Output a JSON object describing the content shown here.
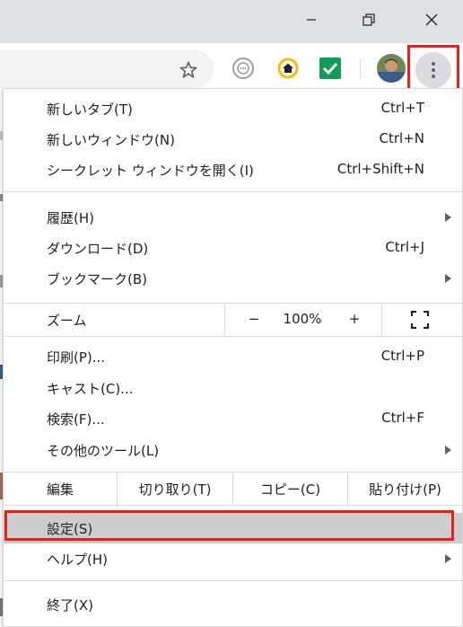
{
  "window": {
    "minimize": "minimize-icon",
    "maximize": "restore-icon",
    "close": "close-icon"
  },
  "toolbar": {
    "bookmark_star": "star-icon",
    "extensions": [
      "chat-extension-icon",
      "home-extension-icon",
      "check-extension-icon"
    ],
    "profile": "avatar",
    "menu_button": "more-vert-icon",
    "highlight_color": "#e2231a"
  },
  "menu": {
    "group1": [
      {
        "label": "新しいタブ(T)",
        "shortcut": "Ctrl+T"
      },
      {
        "label": "新しいウィンドウ(N)",
        "shortcut": "Ctrl+N"
      },
      {
        "label": "シークレット ウィンドウを開く(I)",
        "shortcut": "Ctrl+Shift+N"
      }
    ],
    "group2": [
      {
        "label": "履歴(H)",
        "submenu": true
      },
      {
        "label": "ダウンロード(D)",
        "shortcut": "Ctrl+J"
      },
      {
        "label": "ブックマーク(B)",
        "submenu": true
      }
    ],
    "zoom": {
      "label": "ズーム",
      "minus": "−",
      "value": "100%",
      "plus": "+",
      "fullscreen": "fullscreen-icon"
    },
    "group3": [
      {
        "label": "印刷(P)...",
        "shortcut": "Ctrl+P"
      },
      {
        "label": "キャスト(C)..."
      },
      {
        "label": "検索(F)...",
        "shortcut": "Ctrl+F"
      },
      {
        "label": "その他のツール(L)",
        "submenu": true
      }
    ],
    "edit": {
      "label": "編集",
      "cut": "切り取り(T)",
      "copy": "コピー(C)",
      "paste": "貼り付け(P)"
    },
    "group4": [
      {
        "label": "設定(S)",
        "selected": true
      },
      {
        "label": "ヘルプ(H)",
        "submenu": true
      }
    ],
    "group5": [
      {
        "label": "終了(X)"
      }
    ]
  }
}
